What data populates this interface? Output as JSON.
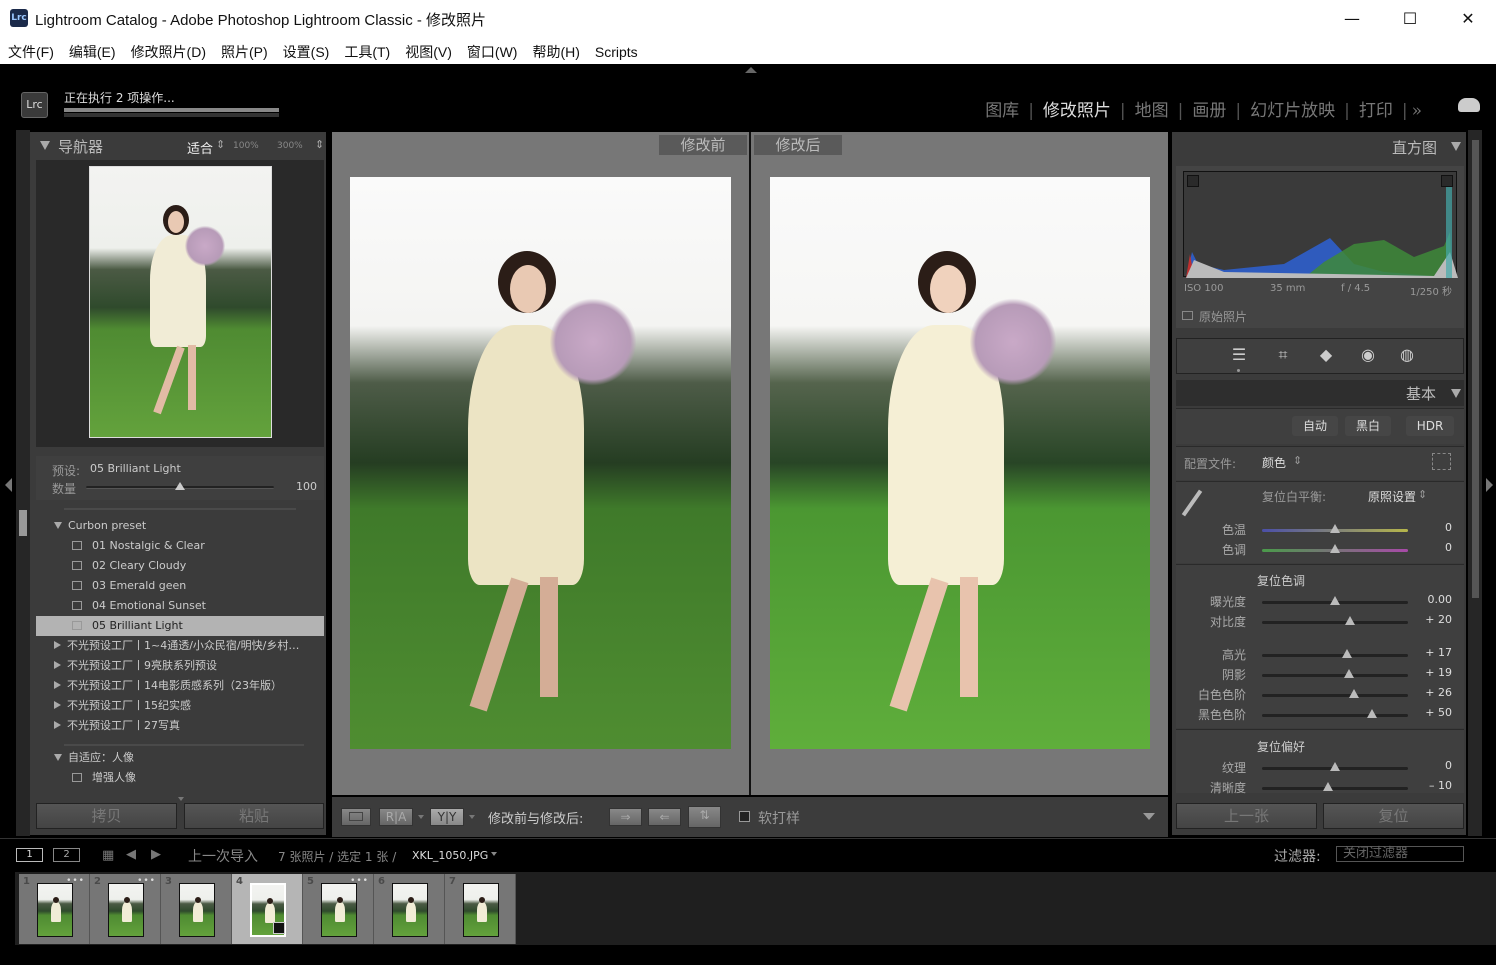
{
  "window": {
    "app_icon": "Lrc",
    "title": "Lightroom Catalog - Adobe Photoshop Lightroom Classic - 修改照片",
    "controls": [
      "minimize",
      "maximize",
      "close"
    ]
  },
  "menu": [
    "文件(F)",
    "编辑(E)",
    "修改照片(D)",
    "照片(P)",
    "设置(S)",
    "工具(T)",
    "视图(V)",
    "窗口(W)",
    "帮助(H)",
    "Scripts"
  ],
  "identity": {
    "logo": "Lrc",
    "status": "正在执行 2 项操作...",
    "progress": 1.0
  },
  "modules": {
    "items": [
      "图库",
      "修改照片",
      "地图",
      "画册",
      "幻灯片放映",
      "打印"
    ],
    "active": "修改照片",
    "more": "»",
    "cloud_icon": "cloud-icon"
  },
  "navigator": {
    "title": "导航器",
    "zoom_fit": "适合",
    "zoom_100": "100%",
    "zoom_300": "300%"
  },
  "preset_amount": {
    "preset_label": "预设:",
    "preset_value": "05 Brilliant Light",
    "amount_label": "数量",
    "amount_value": "100",
    "amount_fraction": 0.5
  },
  "presets": {
    "group_open": "Curbon preset",
    "items": [
      "01 Nostalgic & Clear",
      "02 Cleary Cloudy",
      "03 Emerald geen",
      "04 Emotional Sunset",
      "05 Brilliant Light"
    ],
    "selected": "05 Brilliant Light",
    "collapsed_groups": [
      "不光预设工厂丨1~4通透/小众民宿/明快/乡村…",
      "不光预设工厂丨9亮肤系列预设",
      "不光预设工厂丨14电影质感系列（23年版）",
      "不光预设工厂丨15纪实感",
      "不光预设工厂丨27写真"
    ],
    "group_open_2": "自适应：人像",
    "group_open_2_items": [
      "增强人像"
    ]
  },
  "left_buttons": {
    "copy": "拷贝",
    "paste": "粘贴"
  },
  "view": {
    "before_label": "修改前",
    "after_label": "修改后"
  },
  "toolbar": {
    "loupe": "□",
    "ra": "R|A",
    "yy": "Y|Y",
    "before_after_label": "修改前与修改后:",
    "swap_right": "⇒",
    "swap_left": "⇐",
    "swap_both": "⇅",
    "softproof_label": "软打样"
  },
  "histogram": {
    "title": "直方图",
    "iso": "ISO 100",
    "focal": "35 mm",
    "aperture": "f / 4.5",
    "shutter": "1/250 秒",
    "original_photo": "原始照片"
  },
  "tool_icons": [
    "sliders-icon",
    "crop-icon",
    "eraser-icon",
    "redeye-icon",
    "mask-icon"
  ],
  "basic": {
    "title": "基本",
    "auto": "自动",
    "bw": "黑白",
    "hdr": "HDR",
    "profile_label": "配置文件:",
    "profile_value": "颜色",
    "wb_label": "复位白平衡:",
    "wb_value": "原照设置",
    "tone_label": "复位色调",
    "presence_label": "复位偏好",
    "sliders": [
      {
        "name": "色温",
        "value": "0",
        "pos": 0.5
      },
      {
        "name": "色调",
        "value": "0",
        "pos": 0.5
      },
      {
        "name": "曝光度",
        "value": "0.00",
        "pos": 0.5
      },
      {
        "name": "对比度",
        "value": "+ 20",
        "pos": 0.6
      },
      {
        "name": "高光",
        "value": "+ 17",
        "pos": 0.585
      },
      {
        "name": "阴影",
        "value": "+ 19",
        "pos": 0.595
      },
      {
        "name": "白色色阶",
        "value": "+ 26",
        "pos": 0.63
      },
      {
        "name": "黑色色阶",
        "value": "+ 50",
        "pos": 0.75
      },
      {
        "name": "纹理",
        "value": "0",
        "pos": 0.5
      },
      {
        "name": "清晰度",
        "value": "– 10",
        "pos": 0.45
      }
    ]
  },
  "right_buttons": {
    "prev": "上一张",
    "reset": "复位"
  },
  "filmbar": {
    "screen1": "1",
    "screen2": "2",
    "source": "上一次导入",
    "count": "7 张照片 / 选定 1 张 /",
    "filename": "XKL_1050.JPG",
    "filter_label": "过滤器:",
    "filter_value": "关闭过滤器"
  },
  "filmstrip": {
    "cells": [
      {
        "num": "1",
        "dots": true
      },
      {
        "num": "2",
        "dots": true
      },
      {
        "num": "3",
        "dots": false
      },
      {
        "num": "4",
        "dots": false,
        "selected": true
      },
      {
        "num": "5",
        "dots": true
      },
      {
        "num": "6",
        "dots": false
      },
      {
        "num": "7",
        "dots": false
      }
    ]
  }
}
